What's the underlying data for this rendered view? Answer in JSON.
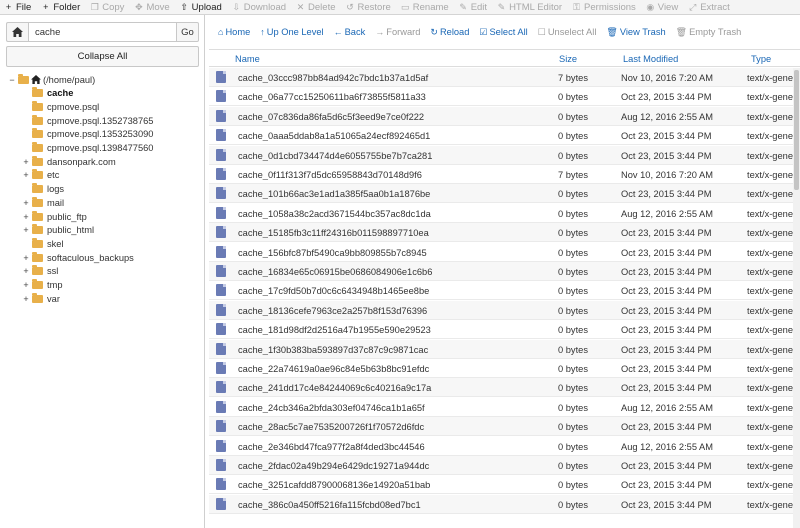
{
  "toolbar": [
    {
      "label": "File",
      "icon": "plus-icon",
      "glyph": "+",
      "enabled": true
    },
    {
      "label": "Folder",
      "icon": "plus-icon",
      "glyph": "+",
      "enabled": true
    },
    {
      "label": "Copy",
      "icon": "copy-icon",
      "glyph": "❐",
      "enabled": false
    },
    {
      "label": "Move",
      "icon": "move-icon",
      "glyph": "✥",
      "enabled": false
    },
    {
      "label": "Upload",
      "icon": "upload-icon",
      "glyph": "⇧",
      "enabled": true
    },
    {
      "label": "Download",
      "icon": "download-icon",
      "glyph": "⇩",
      "enabled": false
    },
    {
      "label": "Delete",
      "icon": "delete-icon",
      "glyph": "✕",
      "enabled": false
    },
    {
      "label": "Restore",
      "icon": "restore-icon",
      "glyph": "↺",
      "enabled": false
    },
    {
      "label": "Rename",
      "icon": "rename-icon",
      "glyph": "▭",
      "enabled": false
    },
    {
      "label": "Edit",
      "icon": "edit-icon",
      "glyph": "✎",
      "enabled": false
    },
    {
      "label": "HTML Editor",
      "icon": "html-editor-icon",
      "glyph": "✎",
      "enabled": false
    },
    {
      "label": "Permissions",
      "icon": "key-icon",
      "glyph": "⚿",
      "enabled": false
    },
    {
      "label": "View",
      "icon": "eye-icon",
      "glyph": "◉",
      "enabled": false
    },
    {
      "label": "Extract",
      "icon": "extract-icon",
      "glyph": "⤢",
      "enabled": false
    }
  ],
  "sidebar": {
    "path_value": "cache",
    "go_label": "Go",
    "collapse_label": "Collapse All",
    "tree": [
      {
        "label": "(/home/paul)",
        "level": 0,
        "toggle": "−",
        "type": "home",
        "bold": false
      },
      {
        "label": "cache",
        "level": 1,
        "toggle": "",
        "type": "folder",
        "bold": true
      },
      {
        "label": "cpmove.psql",
        "level": 1,
        "toggle": "",
        "type": "folder",
        "bold": false
      },
      {
        "label": "cpmove.psql.1352738765",
        "level": 1,
        "toggle": "",
        "type": "folder",
        "bold": false
      },
      {
        "label": "cpmove.psql.1353253090",
        "level": 1,
        "toggle": "",
        "type": "folder",
        "bold": false
      },
      {
        "label": "cpmove.psql.1398477560",
        "level": 1,
        "toggle": "",
        "type": "folder",
        "bold": false
      },
      {
        "label": "dansonpark.com",
        "level": 1,
        "toggle": "+",
        "type": "folder",
        "bold": false
      },
      {
        "label": "etc",
        "level": 1,
        "toggle": "+",
        "type": "folder",
        "bold": false
      },
      {
        "label": "logs",
        "level": 1,
        "toggle": "",
        "type": "folder",
        "bold": false
      },
      {
        "label": "mail",
        "level": 1,
        "toggle": "+",
        "type": "folder",
        "bold": false
      },
      {
        "label": "public_ftp",
        "level": 1,
        "toggle": "+",
        "type": "folder",
        "bold": false
      },
      {
        "label": "public_html",
        "level": 1,
        "toggle": "+",
        "type": "folder",
        "bold": false
      },
      {
        "label": "skel",
        "level": 1,
        "toggle": "",
        "type": "folder",
        "bold": false
      },
      {
        "label": "softaculous_backups",
        "level": 1,
        "toggle": "+",
        "type": "folder",
        "bold": false
      },
      {
        "label": "ssl",
        "level": 1,
        "toggle": "+",
        "type": "folder",
        "bold": false
      },
      {
        "label": "tmp",
        "level": 1,
        "toggle": "+",
        "type": "folder",
        "bold": false
      },
      {
        "label": "var",
        "level": 1,
        "toggle": "+",
        "type": "folder",
        "bold": false
      }
    ]
  },
  "nav": [
    {
      "label": "Home",
      "icon": "home-icon",
      "glyph": "⌂",
      "enabled": true
    },
    {
      "label": "Up One Level",
      "icon": "up-icon",
      "glyph": "↑",
      "enabled": true
    },
    {
      "label": "Back",
      "icon": "back-icon",
      "glyph": "←",
      "enabled": true
    },
    {
      "label": "Forward",
      "icon": "forward-icon",
      "glyph": "→",
      "enabled": false
    },
    {
      "label": "Reload",
      "icon": "reload-icon",
      "glyph": "↻",
      "enabled": true
    },
    {
      "label": "Select All",
      "icon": "checked-box-icon",
      "glyph": "☑",
      "enabled": true
    },
    {
      "label": "Unselect All",
      "icon": "unchecked-box-icon",
      "glyph": "☐",
      "enabled": false
    },
    {
      "label": "View Trash",
      "icon": "trash-icon",
      "glyph": "🗑",
      "enabled": true
    },
    {
      "label": "Empty Trash",
      "icon": "trash-icon",
      "glyph": "🗑",
      "enabled": false
    }
  ],
  "columns": {
    "name": "Name",
    "size": "Size",
    "modified": "Last Modified",
    "type": "Type"
  },
  "files": [
    {
      "name": "cache_03ccc987bb84ad942c7bdc1b37a1d5af",
      "size": "7 bytes",
      "modified": "Nov 10, 2016 7:20 AM",
      "type": "text/x-generic"
    },
    {
      "name": "cache_06a77cc15250611ba6f73855f5811a33",
      "size": "0 bytes",
      "modified": "Oct 23, 2015 3:44 PM",
      "type": "text/x-generic"
    },
    {
      "name": "cache_07c836da86fa5d6c5f3eed9e7ce0f222",
      "size": "0 bytes",
      "modified": "Aug 12, 2016 2:55 AM",
      "type": "text/x-generic"
    },
    {
      "name": "cache_0aaa5ddab8a1a51065a24ecf892465d1",
      "size": "0 bytes",
      "modified": "Oct 23, 2015 3:44 PM",
      "type": "text/x-generic"
    },
    {
      "name": "cache_0d1cbd734474d4e6055755be7b7ca281",
      "size": "0 bytes",
      "modified": "Oct 23, 2015 3:44 PM",
      "type": "text/x-generic"
    },
    {
      "name": "cache_0f11f313f7d5dc65958843d70148d9f6",
      "size": "7 bytes",
      "modified": "Nov 10, 2016 7:20 AM",
      "type": "text/x-generic"
    },
    {
      "name": "cache_101b66ac3e1ad1a385f5aa0b1a1876be",
      "size": "0 bytes",
      "modified": "Oct 23, 2015 3:44 PM",
      "type": "text/x-generic"
    },
    {
      "name": "cache_1058a38c2acd3671544bc357ac8dc1da",
      "size": "0 bytes",
      "modified": "Aug 12, 2016 2:55 AM",
      "type": "text/x-generic"
    },
    {
      "name": "cache_15185fb3c11ff24316b011598897710ea",
      "size": "0 bytes",
      "modified": "Oct 23, 2015 3:44 PM",
      "type": "text/x-generic"
    },
    {
      "name": "cache_156bfc87bf5490ca9bb809855b7c8945",
      "size": "0 bytes",
      "modified": "Oct 23, 2015 3:44 PM",
      "type": "text/x-generic"
    },
    {
      "name": "cache_16834e65c06915be0686084906e1c6b6",
      "size": "0 bytes",
      "modified": "Oct 23, 2015 3:44 PM",
      "type": "text/x-generic"
    },
    {
      "name": "cache_17c9fd50b7d0c6c6434948b1465ee8be",
      "size": "0 bytes",
      "modified": "Oct 23, 2015 3:44 PM",
      "type": "text/x-generic"
    },
    {
      "name": "cache_18136cefe7963ce2a257b8f153d76396",
      "size": "0 bytes",
      "modified": "Oct 23, 2015 3:44 PM",
      "type": "text/x-generic"
    },
    {
      "name": "cache_181d98df2d2516a47b1955e590e29523",
      "size": "0 bytes",
      "modified": "Oct 23, 2015 3:44 PM",
      "type": "text/x-generic"
    },
    {
      "name": "cache_1f30b383ba593897d37c87c9c9871cac",
      "size": "0 bytes",
      "modified": "Oct 23, 2015 3:44 PM",
      "type": "text/x-generic"
    },
    {
      "name": "cache_22a74619a0ae96c84e5b63b8bc91efdc",
      "size": "0 bytes",
      "modified": "Oct 23, 2015 3:44 PM",
      "type": "text/x-generic"
    },
    {
      "name": "cache_241dd17c4e84244069c6c40216a9c17a",
      "size": "0 bytes",
      "modified": "Oct 23, 2015 3:44 PM",
      "type": "text/x-generic"
    },
    {
      "name": "cache_24cb346a2bfda303ef04746ca1b1a65f",
      "size": "0 bytes",
      "modified": "Aug 12, 2016 2:55 AM",
      "type": "text/x-generic"
    },
    {
      "name": "cache_28ac5c7ae7535200726f1f70572d6fdc",
      "size": "0 bytes",
      "modified": "Oct 23, 2015 3:44 PM",
      "type": "text/x-generic"
    },
    {
      "name": "cache_2e346bd47fca977f2a8f4ded3bc44546",
      "size": "0 bytes",
      "modified": "Aug 12, 2016 2:55 AM",
      "type": "text/x-generic"
    },
    {
      "name": "cache_2fdac02a49b294e6429dc19271a944dc",
      "size": "0 bytes",
      "modified": "Oct 23, 2015 3:44 PM",
      "type": "text/x-generic"
    },
    {
      "name": "cache_3251cafdd87900068136e14920a51bab",
      "size": "0 bytes",
      "modified": "Oct 23, 2015 3:44 PM",
      "type": "text/x-generic"
    },
    {
      "name": "cache_386c0a450ff5216fa115fcbd08ed7bc1",
      "size": "0 bytes",
      "modified": "Oct 23, 2015 3:44 PM",
      "type": "text/x-generic"
    }
  ]
}
